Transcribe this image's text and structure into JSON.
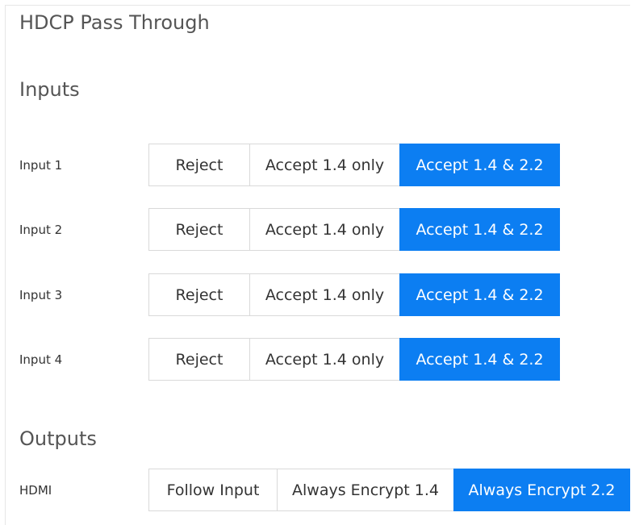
{
  "page": {
    "title": "HDCP Pass Through"
  },
  "inputs": {
    "heading": "Inputs",
    "rows": [
      {
        "label": "Input 1",
        "options": [
          "Reject",
          "Accept 1.4 only",
          "Accept 1.4 & 2.2"
        ],
        "selected": "Accept 1.4 & 2.2"
      },
      {
        "label": "Input 2",
        "options": [
          "Reject",
          "Accept 1.4 only",
          "Accept 1.4 & 2.2"
        ],
        "selected": "Accept 1.4 & 2.2"
      },
      {
        "label": "Input 3",
        "options": [
          "Reject",
          "Accept 1.4 only",
          "Accept 1.4 & 2.2"
        ],
        "selected": "Accept 1.4 & 2.2"
      },
      {
        "label": "Input 4",
        "options": [
          "Reject",
          "Accept 1.4 only",
          "Accept 1.4 & 2.2"
        ],
        "selected": "Accept 1.4 & 2.2"
      }
    ]
  },
  "outputs": {
    "heading": "Outputs",
    "rows": [
      {
        "label": "HDMI",
        "options": [
          "Follow Input",
          "Always Encrypt 1.4",
          "Always Encrypt 2.2"
        ],
        "selected": "Always Encrypt 2.2"
      }
    ]
  },
  "colors": {
    "accent": "#0c7ef2",
    "border": "#d9d9d9",
    "heading": "#555555"
  }
}
